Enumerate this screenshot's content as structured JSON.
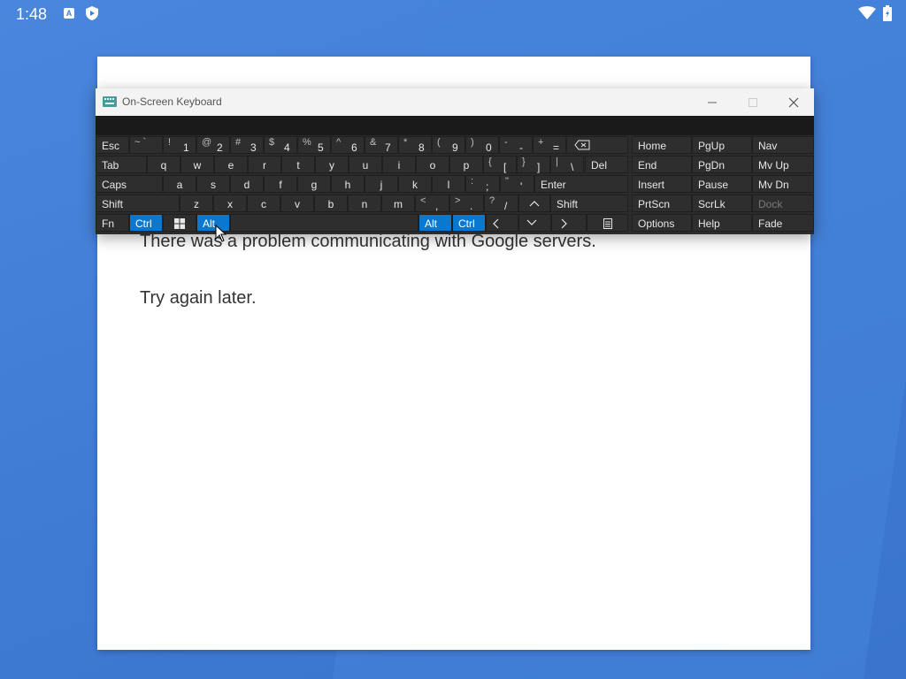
{
  "status_bar": {
    "time": "1:48",
    "a_icon_label": "A"
  },
  "dialog": {
    "message": "There was a problem communicating with Google servers.",
    "retry": "Try again later."
  },
  "osk": {
    "title": "On-Screen Keyboard",
    "keys": {
      "esc": "Esc",
      "tab": "Tab",
      "caps": "Caps",
      "shift_l": "Shift",
      "fn": "Fn",
      "ctrl_l": "Ctrl",
      "alt_l": "Alt",
      "alt_r": "Alt",
      "ctrl_r": "Ctrl",
      "del": "Del",
      "enter": "Enter",
      "shift_r": "Shift",
      "row1": [
        {
          "sym": "~ `",
          "ch": ""
        },
        {
          "sym": "!",
          "ch": "1"
        },
        {
          "sym": "@",
          "ch": "2"
        },
        {
          "sym": "#",
          "ch": "3"
        },
        {
          "sym": "$",
          "ch": "4"
        },
        {
          "sym": "%",
          "ch": "5"
        },
        {
          "sym": "^",
          "ch": "6"
        },
        {
          "sym": "&",
          "ch": "7"
        },
        {
          "sym": "*",
          "ch": "8"
        },
        {
          "sym": "(",
          "ch": "9"
        },
        {
          "sym": ")",
          "ch": "0"
        },
        {
          "sym": "-",
          "ch": "-"
        },
        {
          "sym": "+",
          "ch": "="
        }
      ],
      "row2": [
        "q",
        "w",
        "e",
        "r",
        "t",
        "y",
        "u",
        "i",
        "o",
        "p"
      ],
      "row2_sym": [
        {
          "sym": "{",
          "ch": "["
        },
        {
          "sym": "}",
          "ch": "]"
        },
        {
          "sym": "|",
          "ch": "\\"
        }
      ],
      "row3": [
        "a",
        "s",
        "d",
        "f",
        "g",
        "h",
        "j",
        "k",
        "l"
      ],
      "row3_sym": [
        {
          "sym": ":",
          "ch": ";"
        },
        {
          "sym": "\"",
          "ch": "'"
        }
      ],
      "row4": [
        "z",
        "x",
        "c",
        "v",
        "b",
        "n",
        "m"
      ],
      "row4_sym": [
        {
          "sym": "<",
          "ch": ","
        },
        {
          "sym": ">",
          "ch": "."
        },
        {
          "sym": "?",
          "ch": "/"
        }
      ]
    },
    "nav_keys": {
      "home": "Home",
      "pgup": "PgUp",
      "nav": "Nav",
      "end": "End",
      "pgdn": "PgDn",
      "mvup": "Mv Up",
      "insert": "Insert",
      "pause": "Pause",
      "mvdn": "Mv Dn",
      "prtscn": "PrtScn",
      "scrlk": "ScrLk",
      "dock": "Dock",
      "options": "Options",
      "help": "Help",
      "fade": "Fade"
    }
  },
  "colors": {
    "accent": "#0b78d0",
    "desktop": "#3f7dd6",
    "key_bg": "#2e2e2e"
  }
}
